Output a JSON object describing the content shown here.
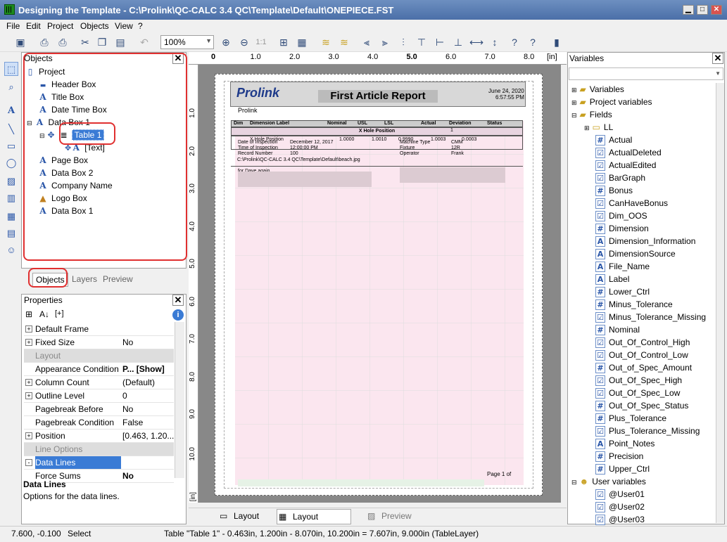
{
  "window": {
    "title": "Designing the Template - C:\\Prolink\\QC-CALC 3.4 QC\\Template\\Default\\ONEPIECE.FST",
    "min": "▁",
    "max": "□",
    "close": "✕"
  },
  "menu": [
    "File",
    "Edit",
    "Project",
    "Objects",
    "View",
    "?"
  ],
  "toolbar": {
    "zoom": "100%",
    "zoom_ratio": "1:1"
  },
  "objects_panel": {
    "title": "Objects",
    "close": "✕",
    "items": [
      {
        "label": "Project",
        "icon": "page-icon"
      },
      {
        "label": "Header Box",
        "icon": "box-icon"
      },
      {
        "label": "Title Box",
        "icon": "text-icon"
      },
      {
        "label": "Date Time Box",
        "icon": "text-icon"
      },
      {
        "label": "Data Box 1",
        "icon": "text-icon"
      },
      {
        "label": "Table 1",
        "icon": "table-icon"
      },
      {
        "label": "[Text]",
        "icon": "text-icon"
      },
      {
        "label": "Page Box",
        "icon": "text-icon"
      },
      {
        "label": "Data Box 2",
        "icon": "text-icon"
      },
      {
        "label": "Company Name",
        "icon": "text-icon"
      },
      {
        "label": "Logo Box",
        "icon": "image-icon"
      },
      {
        "label": "Data Box 1",
        "icon": "text-icon"
      }
    ],
    "tabs": [
      "Objects",
      "Layers",
      "Preview"
    ]
  },
  "properties_panel": {
    "title": "Properties",
    "close": "✕",
    "sort_label": "[+]",
    "rows": [
      {
        "k": "Default Frame",
        "v": "",
        "pm": "+"
      },
      {
        "k": "Fixed Size",
        "v": "No",
        "pm": "+"
      },
      {
        "k": "Layout",
        "v": "",
        "cat": true
      },
      {
        "k": "Appearance Condition",
        "v": "P... [Show]"
      },
      {
        "k": "Column Count",
        "v": "(Default)",
        "pm": "+"
      },
      {
        "k": "Outline Level",
        "v": "0",
        "pm": "+"
      },
      {
        "k": "Pagebreak Before",
        "v": "No"
      },
      {
        "k": "Pagebreak Condition",
        "v": "False"
      },
      {
        "k": "Position",
        "v": "[0.463, 1.20...",
        "pm": "+"
      },
      {
        "k": "Line Options",
        "v": "",
        "cat": true
      },
      {
        "k": "Data Lines",
        "v": "",
        "pm": "-",
        "sel": true
      },
      {
        "k": "Force Sums",
        "v": "No"
      }
    ],
    "desc_title": "Data Lines",
    "desc_text": "Options for the data lines."
  },
  "ruler": {
    "top": [
      "0",
      "1.0",
      "2.0",
      "3.0",
      "4.0",
      "5.0",
      "6.0",
      "7.0",
      "8.0"
    ],
    "unit": "[in]",
    "left": [
      "1.0",
      "2.0",
      "3.0",
      "4.0",
      "5.0",
      "6.0",
      "7.0",
      "8.0",
      "9.0",
      "10.0"
    ],
    "left_unit": "[in]"
  },
  "report": {
    "logo": "Prolink",
    "title": "First Article Report",
    "date": "June 24, 2020",
    "time": "6:57:55 PM",
    "company": "Prolink",
    "headers": [
      "Dim",
      "Dimension Label",
      "Nominal",
      "USL",
      "LSL",
      "Actual",
      "Deviation",
      "Status"
    ],
    "group": "X Hole Position",
    "row": [
      "1",
      "X Hole Position",
      "1.0000",
      "1.0010",
      "0.9990",
      "1.0003",
      "0.0003",
      ""
    ],
    "info": [
      [
        "Date of Inspection",
        "December 12, 2017",
        "Machine Type",
        "CMM"
      ],
      [
        "Time of Inspection",
        "12:00:00 PM",
        "Fixture",
        "12R"
      ],
      [
        "Record Number",
        "100",
        "Operator",
        "Frank"
      ]
    ],
    "path": "C:\\Prolink\\QC-CALC 3.4 QC\\Template\\Default\\beach.jpg",
    "note": "for Dave again",
    "page": "Page 1 of"
  },
  "bottom_tabs": [
    "Layout",
    "Layout Preview",
    "Preview"
  ],
  "variables_panel": {
    "title": "Variables",
    "close": "✕",
    "groups": [
      "Variables",
      "Project variables",
      "Fields"
    ],
    "ll": "LL",
    "fields": [
      "Actual",
      "ActualDeleted",
      "ActualEdited",
      "BarGraph",
      "Bonus",
      "CanHaveBonus",
      "Dim_OOS",
      "Dimension",
      "Dimension_Information",
      "DimensionSource",
      "File_Name",
      "Label",
      "Lower_Ctrl",
      "Minus_Tolerance",
      "Minus_Tolerance_Missing",
      "Nominal",
      "Out_Of_Control_High",
      "Out_Of_Control_Low",
      "Out_of_Spec_Amount",
      "Out_Of_Spec_High",
      "Out_Of_Spec_Low",
      "Out_Of_Spec_Status",
      "Plus_Tolerance",
      "Plus_Tolerance_Missing",
      "Point_Notes",
      "Precision",
      "Upper_Ctrl"
    ],
    "user_group": "User variables",
    "users": [
      "@User01",
      "@User02",
      "@User03"
    ]
  },
  "status": {
    "coords": "7.600, -0.100",
    "mode": "Select",
    "info": "Table \"Table 1\" - 0.463in, 1.200in - 8.070in, 10.200in = 7.607in, 9.000in (TableLayer)"
  }
}
